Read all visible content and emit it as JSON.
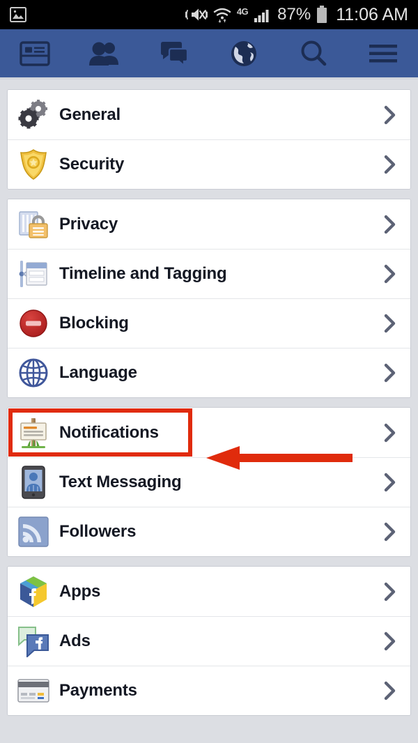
{
  "statusbar": {
    "left_icons": [
      {
        "name": "image-icon",
        "label": "image"
      }
    ],
    "right_icons": [
      {
        "name": "vibrate-mute-icon",
        "label": "vibrate-mute"
      },
      {
        "name": "wifi-icon",
        "label": "wifi"
      },
      {
        "name": "network-4g-icon",
        "label": "4G"
      },
      {
        "name": "cell-signal-icon",
        "label": "signal"
      }
    ],
    "battery_percent": "87%",
    "time": "11:06 AM"
  },
  "navbar": {
    "background": "#3b5998",
    "items": [
      {
        "name": "newsfeed-icon",
        "label": "News Feed"
      },
      {
        "name": "friend-requests-icon",
        "label": "Friend Requests"
      },
      {
        "name": "messages-icon",
        "label": "Messages"
      },
      {
        "name": "notifications-globe-icon",
        "label": "Notifications"
      },
      {
        "name": "search-icon",
        "label": "Search"
      },
      {
        "name": "menu-icon",
        "label": "More"
      }
    ]
  },
  "annotation": {
    "color": "#e02b0c",
    "type": "arrow-left",
    "target": "Notifications"
  },
  "settings": {
    "groups": [
      {
        "rows": [
          {
            "label": "General",
            "icon": "gears-icon"
          },
          {
            "label": "Security",
            "icon": "shield-badge-icon"
          }
        ]
      },
      {
        "rows": [
          {
            "label": "Privacy",
            "icon": "lock-document-icon"
          },
          {
            "label": "Timeline and Tagging",
            "icon": "timeline-icon"
          },
          {
            "label": "Blocking",
            "icon": "block-icon"
          },
          {
            "label": "Language",
            "icon": "globe-icon"
          }
        ]
      },
      {
        "rows": [
          {
            "label": "Notifications",
            "icon": "signpost-icon",
            "highlighted": true
          },
          {
            "label": "Text Messaging",
            "icon": "mobile-phone-icon"
          },
          {
            "label": "Followers",
            "icon": "rss-followers-icon"
          }
        ]
      },
      {
        "rows": [
          {
            "label": "Apps",
            "icon": "app-cube-icon"
          },
          {
            "label": "Ads",
            "icon": "ads-bubbles-icon"
          },
          {
            "label": "Payments",
            "icon": "credit-card-icon"
          }
        ]
      }
    ]
  }
}
